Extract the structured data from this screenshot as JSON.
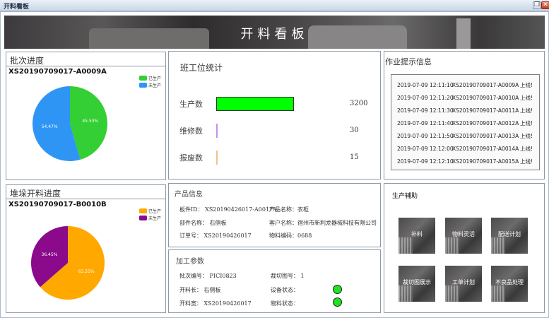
{
  "window": {
    "title": "开料看板"
  },
  "banner": {
    "title": "开料看板"
  },
  "batch": {
    "header": "批次进度",
    "code": "XS20190709017-A0009A",
    "legend": [
      {
        "label": "已生产",
        "color": "#34cf34"
      },
      {
        "label": "未生产",
        "color": "#2f95f5"
      }
    ],
    "slices": [
      {
        "label": "45.53%",
        "value": 45.53,
        "color": "#34cf34"
      },
      {
        "label": "54.47%",
        "value": 54.47,
        "color": "#2f95f5"
      }
    ]
  },
  "stack": {
    "header": "堆垛开料进度",
    "code": "XS20190709017-B0010B",
    "legend": [
      {
        "label": "已生产",
        "color": "#ffa800"
      },
      {
        "label": "未生产",
        "color": "#8b0a8b"
      }
    ],
    "slices": [
      {
        "label": "63.55%",
        "value": 63.55,
        "color": "#ffa800"
      },
      {
        "label": "36.45%",
        "value": 36.45,
        "color": "#8b0a8b"
      }
    ]
  },
  "station": {
    "title": "班工位统计",
    "rows": [
      {
        "label": "生产数",
        "value": "3200",
        "count": 3200,
        "color": "#00ff00"
      },
      {
        "label": "维修数",
        "value": "30",
        "count": 30,
        "color": "#c98ef0"
      },
      {
        "label": "报废数",
        "value": "15",
        "count": 15,
        "color": "#f6c08a"
      }
    ]
  },
  "notice": {
    "title": "作业提示信息",
    "rows": [
      {
        "time": "2019-07-09 12:11:10",
        "code": "XS20190709017-A0009A",
        "state": "上线!"
      },
      {
        "time": "2019-07-09 12:11:20",
        "code": "XS20190709017-A0010A",
        "state": "上线!"
      },
      {
        "time": "2019-07-09 12:11:30",
        "code": "XS20190709017-A0011A",
        "state": "上线!"
      },
      {
        "time": "2019-07-09 12:11:40",
        "code": "XS20190709017-A0012A",
        "state": "上线!"
      },
      {
        "time": "2019-07-09 12:11:50",
        "code": "XS20190709017-A0013A",
        "state": "上线!"
      },
      {
        "time": "2019-07-09 12:12:00",
        "code": "XS20190709017-A0014A",
        "state": "上线!"
      },
      {
        "time": "2019-07-09 12:12:10",
        "code": "XS20190709017-A0015A",
        "state": "上线!"
      }
    ]
  },
  "product": {
    "title": "产品信息",
    "part_id_label": "板件ID：",
    "part_id": "XS20190426017-A0017A",
    "product_name_label": "产品名称：",
    "product_name": "衣柜",
    "part_name_label": "部件名称：",
    "part_name": "右侧板",
    "customer_label": "客户名称：",
    "customer": "宿州市新利龙器械科技有限公司",
    "order_label": "订单号：",
    "order": "XS20190426017",
    "material_label": "物料编码：",
    "material": "0688"
  },
  "process": {
    "title": "加工参数",
    "batch_label": "批次编号：",
    "batch": "PICI0823",
    "cut_label": "裁切图号：",
    "cut": "1",
    "length_label": "开料长：",
    "length": "右侧板",
    "device_label": "设备状态：",
    "width_label": "开料宽：",
    "width": "XS20190426017",
    "material_label": "物料状态：",
    "status_color": "#1fe31f"
  },
  "assist": {
    "title": "生产辅助",
    "tiles": [
      "补料",
      "物料灵活",
      "配送计划",
      "裁切图展示",
      "工单计划",
      "不良品处理"
    ]
  }
}
